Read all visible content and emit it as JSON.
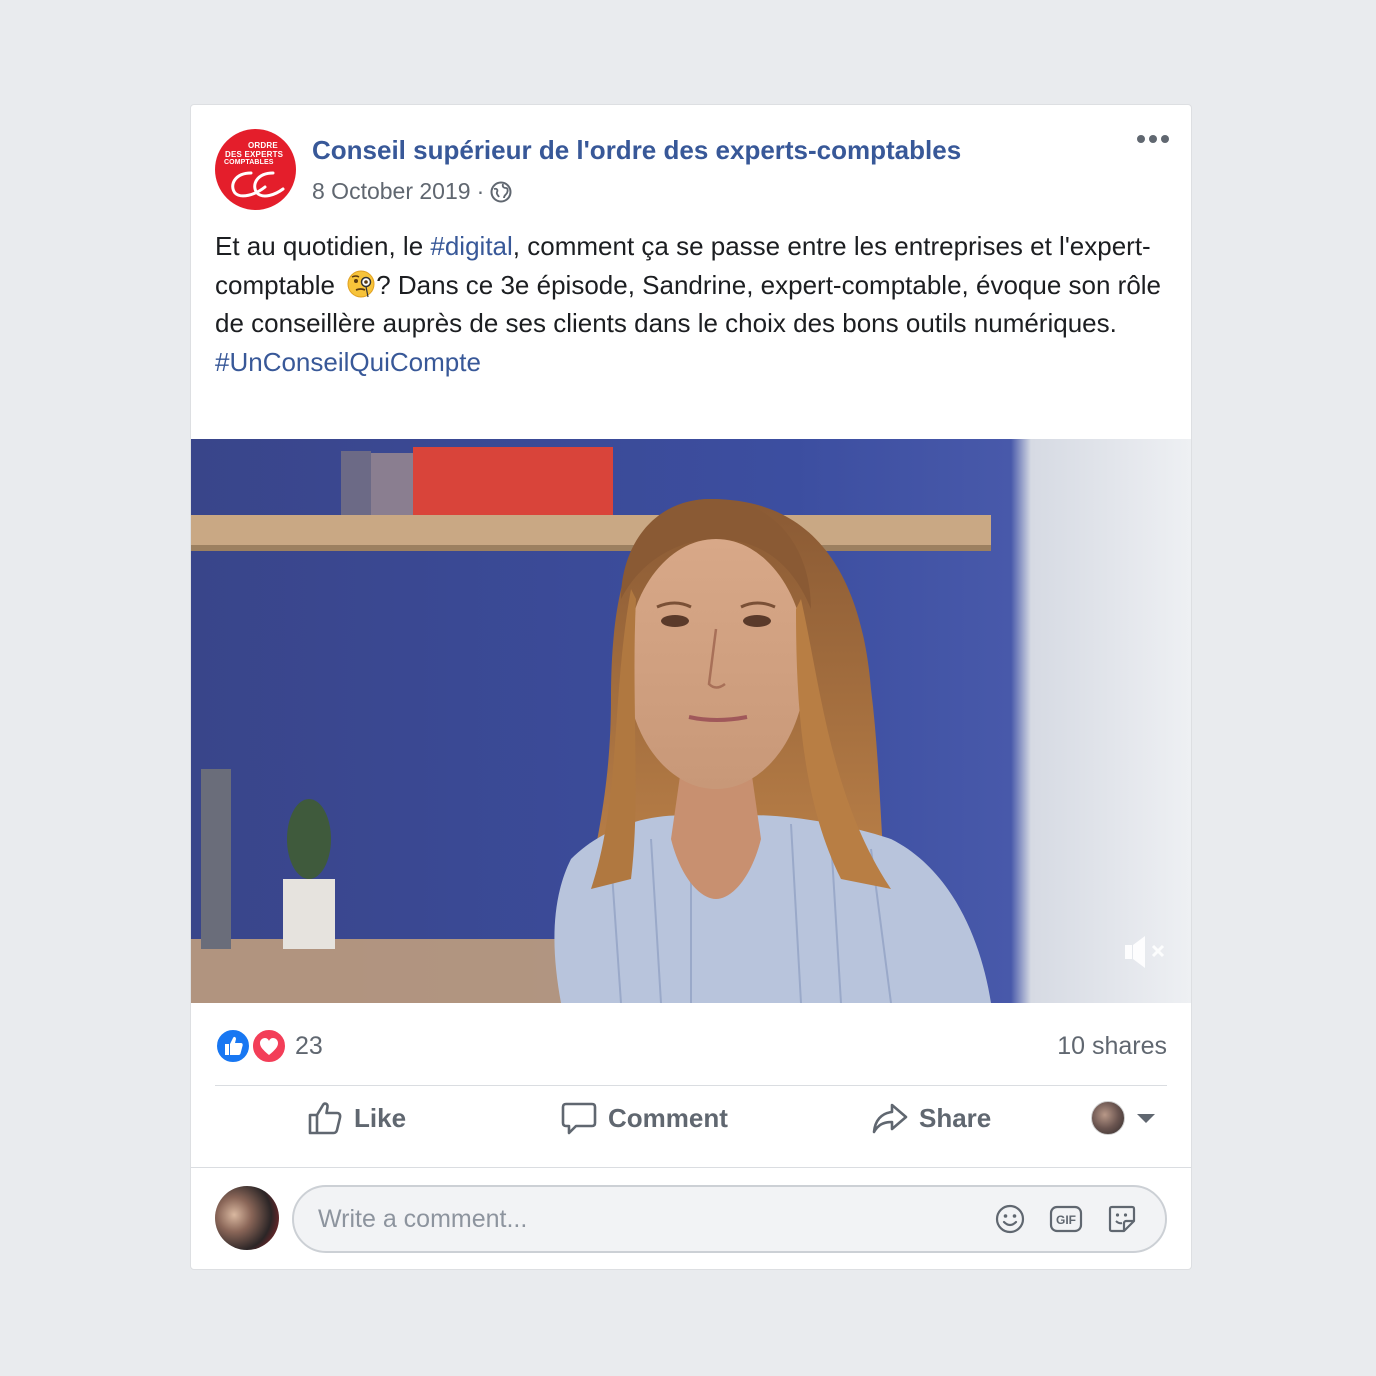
{
  "post": {
    "page_name": "Conseil supérieur de l'ordre des experts-comptables",
    "date": "8 October 2019",
    "separator": "·",
    "privacy_icon": "globe-icon",
    "logo_text": {
      "line1": "ORDRE",
      "line2": "DES EXPERTS",
      "line3": "COMPTABLES"
    },
    "text": {
      "part1": "Et au quotidien, le ",
      "hashtag1": "#digital",
      "part2": ", comment ça se passe entre les entreprises et l'expert-comptable ",
      "emoji": "face-with-monocle",
      "part3": "? Dans ce 3e épisode, Sandrine, expert-comptable, évoque son rôle de conseillère auprès de ses clients dans le choix des bons outils numériques.",
      "hashtag2": "#UnConseilQuiCompte"
    }
  },
  "video": {
    "mute_icon": "volume-muted-icon"
  },
  "stats": {
    "reactions": [
      "like",
      "love"
    ],
    "reaction_count": "23",
    "shares": "10 shares"
  },
  "actions": {
    "like": "Like",
    "comment": "Comment",
    "share": "Share"
  },
  "composer": {
    "placeholder": "Write a comment...",
    "icons": [
      "smiley-icon",
      "gif-icon",
      "sticker-icon"
    ]
  },
  "colors": {
    "link": "#385898",
    "muted": "#606770",
    "like_blue": "#1877f2",
    "love_red": "#f33e58",
    "brand_red": "#e41e2b"
  }
}
